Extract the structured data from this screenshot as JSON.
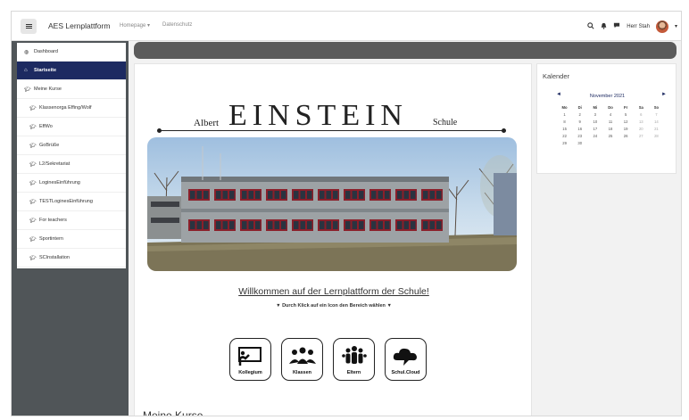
{
  "navbar": {
    "brand": "AES Lernplattform",
    "links": [
      "Homepage",
      "Datenschutz"
    ],
    "user_name": "Herr Stah"
  },
  "sidebar": {
    "items": [
      {
        "label": "Dashboard",
        "icon": "dashboard-icon",
        "active": false,
        "sub": false
      },
      {
        "label": "Startseite",
        "icon": "home-icon",
        "active": true,
        "sub": false
      },
      {
        "label": "Meine Kurse",
        "icon": "graduation-cap-icon",
        "active": false,
        "sub": false
      },
      {
        "label": "Klassenorga Effing/Wolf",
        "icon": "graduation-cap-icon",
        "active": false,
        "sub": true
      },
      {
        "label": "EffWo",
        "icon": "graduation-cap-icon",
        "active": false,
        "sub": true
      },
      {
        "label": "GoBrüße",
        "icon": "graduation-cap-icon",
        "active": false,
        "sub": true
      },
      {
        "label": "L2/Sekretariat",
        "icon": "graduation-cap-icon",
        "active": false,
        "sub": true
      },
      {
        "label": "LoginesEinführung",
        "icon": "graduation-cap-icon",
        "active": false,
        "sub": true
      },
      {
        "label": "TESTLoginesEinführung",
        "icon": "graduation-cap-icon",
        "active": false,
        "sub": true
      },
      {
        "label": "For teachers",
        "icon": "graduation-cap-icon",
        "active": false,
        "sub": true
      },
      {
        "label": "Sportintern",
        "icon": "graduation-cap-icon",
        "active": false,
        "sub": true
      },
      {
        "label": "SCInstallation",
        "icon": "graduation-cap-icon",
        "active": false,
        "sub": true
      }
    ]
  },
  "logo": {
    "albert": "Albert",
    "einstein": "EINSTEIN",
    "schule": "Schule"
  },
  "main": {
    "welcome": "Willkommen auf der Lernplattform der Schule!",
    "hint": "▼ Durch Klick auf ein Icon den Bereich wählen ▼",
    "tiles": [
      {
        "label": "Kollegium",
        "icon": "teacher-board-icon"
      },
      {
        "label": "Klassen",
        "icon": "students-group-icon"
      },
      {
        "label": "Eltern",
        "icon": "parents-group-icon"
      },
      {
        "label": "Schul.Cloud",
        "icon": "cloud-chat-icon"
      }
    ],
    "section_title": "Meine Kurse"
  },
  "calendar": {
    "title": "Kalender",
    "month": "November 2021",
    "weekdays": [
      "Mo",
      "Di",
      "Mi",
      "Do",
      "Fr",
      "Sa",
      "So"
    ],
    "days": [
      "1",
      "2",
      "3",
      "4",
      "5",
      "6",
      "7",
      "8",
      "9",
      "10",
      "11",
      "12",
      "13",
      "14",
      "15",
      "16",
      "17",
      "18",
      "19",
      "20",
      "21",
      "22",
      "23",
      "24",
      "25",
      "26",
      "27",
      "28",
      "29",
      "30"
    ]
  },
  "colors": {
    "active_nav": "#1d2a61",
    "sidebar_bg": "#505558",
    "header_bar": "#5b5b5b"
  }
}
